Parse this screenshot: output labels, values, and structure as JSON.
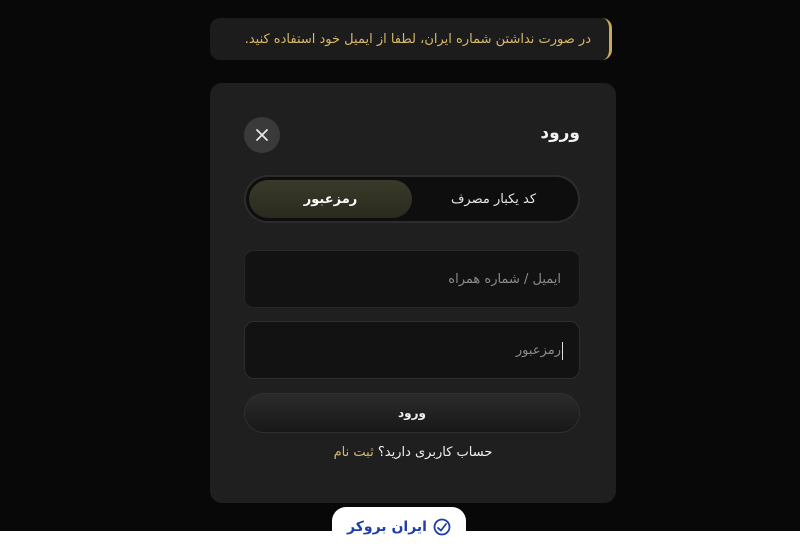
{
  "notice": {
    "text": "در صورت نداشتن شماره ایران، لطفا از ایمیل خود استفاده کنید."
  },
  "login": {
    "title": "ورود",
    "tabs": [
      {
        "label": "کد یکبار مصرف",
        "active": false
      },
      {
        "label": "رمزعبور",
        "active": true
      }
    ],
    "fields": {
      "identifier_placeholder": "ایمیل / شماره همراه",
      "password_placeholder": "رمزعبور"
    },
    "submit_label": "ورود",
    "signup_question": "حساب کاربری دارید؟",
    "signup_link": "ثبت نام"
  },
  "brand": {
    "name": "ایران بروکر"
  },
  "colors": {
    "accent": "#d8b86a",
    "card": "#1f1f1f",
    "background": "#080808",
    "brand": "#1f3fa8"
  }
}
